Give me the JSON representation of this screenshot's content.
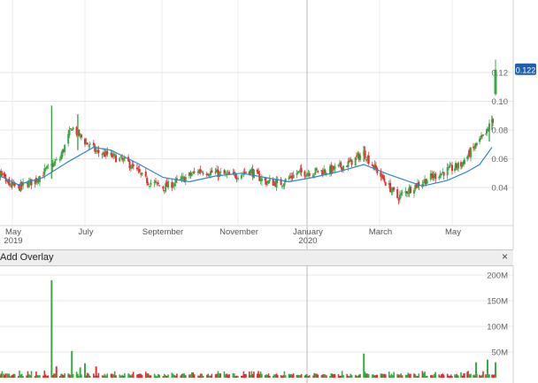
{
  "chart_data": [
    {
      "type": "candlestick",
      "title": "",
      "xlabel": "",
      "ylabel": "",
      "ylim": [
        0.02,
        0.135
      ],
      "y_ticks": [
        "0.04",
        "0.06",
        "0.08",
        "0.10",
        "0.12"
      ],
      "x_labels": [
        {
          "label": "May",
          "sub": "2019",
          "date": "2019-05"
        },
        {
          "label": "July",
          "sub": "",
          "date": "2019-07"
        },
        {
          "label": "September",
          "sub": "",
          "date": "2019-09"
        },
        {
          "label": "November",
          "sub": "",
          "date": "2019-11"
        },
        {
          "label": "January",
          "sub": "2020",
          "date": "2020-01"
        },
        {
          "label": "March",
          "sub": "",
          "date": "2020-03"
        },
        {
          "label": "May",
          "sub": "",
          "date": "2020-05"
        }
      ],
      "last_price": "0.122",
      "series": [
        {
          "name": "",
          "kind": "close",
          "trend": [
            [
              "2019-04-08",
              0.05
            ],
            [
              "2019-04-22",
              0.043
            ],
            [
              "2019-05-06",
              0.04
            ],
            [
              "2019-05-20",
              0.045
            ],
            [
              "2019-06-01",
              0.054
            ],
            [
              "2019-06-10",
              0.06
            ],
            [
              "2019-06-20",
              0.082
            ],
            [
              "2019-07-01",
              0.072
            ],
            [
              "2019-07-10",
              0.065
            ],
            [
              "2019-07-22",
              0.062
            ],
            [
              "2019-08-05",
              0.057
            ],
            [
              "2019-08-19",
              0.045
            ],
            [
              "2019-09-02",
              0.04
            ],
            [
              "2019-09-16",
              0.045
            ],
            [
              "2019-10-01",
              0.052
            ],
            [
              "2019-10-14",
              0.05
            ],
            [
              "2019-10-28",
              0.048
            ],
            [
              "2019-11-11",
              0.052
            ],
            [
              "2019-11-25",
              0.044
            ],
            [
              "2019-12-09",
              0.043
            ],
            [
              "2019-12-23",
              0.05
            ],
            [
              "2020-01-06",
              0.051
            ],
            [
              "2020-01-20",
              0.052
            ],
            [
              "2020-02-03",
              0.056
            ],
            [
              "2020-02-17",
              0.064
            ],
            [
              "2020-03-02",
              0.048
            ],
            [
              "2020-03-16",
              0.033
            ],
            [
              "2020-03-30",
              0.041
            ],
            [
              "2020-04-13",
              0.047
            ],
            [
              "2020-04-27",
              0.052
            ],
            [
              "2020-05-11",
              0.056
            ],
            [
              "2020-05-25",
              0.067
            ],
            [
              "2020-06-08",
              0.077
            ],
            [
              "2020-06-15",
              0.087
            ]
          ]
        },
        {
          "name": "",
          "kind": "moving_average",
          "color": "#2f86c8",
          "trend": [
            [
              "2019-04-08",
              0.048
            ],
            [
              "2019-05-06",
              0.042
            ],
            [
              "2019-05-27",
              0.047
            ],
            [
              "2019-06-17",
              0.058
            ],
            [
              "2019-07-08",
              0.068
            ],
            [
              "2019-07-22",
              0.066
            ],
            [
              "2019-08-12",
              0.057
            ],
            [
              "2019-09-02",
              0.047
            ],
            [
              "2019-09-23",
              0.044
            ],
            [
              "2019-10-14",
              0.048
            ],
            [
              "2019-11-04",
              0.05
            ],
            [
              "2019-11-25",
              0.047
            ],
            [
              "2019-12-16",
              0.044
            ],
            [
              "2020-01-06",
              0.047
            ],
            [
              "2020-01-27",
              0.051
            ],
            [
              "2020-02-17",
              0.056
            ],
            [
              "2020-03-09",
              0.049
            ],
            [
              "2020-04-06",
              0.041
            ],
            [
              "2020-04-27",
              0.045
            ],
            [
              "2020-05-18",
              0.051
            ],
            [
              "2020-06-01",
              0.056
            ],
            [
              "2020-06-15",
              0.068
            ]
          ]
        }
      ],
      "spikes": [
        {
          "date": "2019-06-03",
          "high": 0.097,
          "low": 0.046
        },
        {
          "date": "2019-06-25",
          "high": 0.091,
          "low": 0.066
        },
        {
          "date": "2020-02-17",
          "high": 0.069,
          "low": 0.058
        },
        {
          "date": "2020-06-12",
          "high": 0.084,
          "low": 0.072
        },
        {
          "date": "2020-06-15",
          "high": 0.09,
          "low": 0.08
        }
      ],
      "last_candle": {
        "date": "2020-06-19",
        "open": 0.105,
        "high": 0.129,
        "low": 0.104,
        "close": 0.122
      }
    },
    {
      "type": "bar",
      "title": "",
      "xlabel": "",
      "ylabel": "",
      "ylim": [
        0,
        225
      ],
      "y_ticks": [
        "50M",
        "100M",
        "150M",
        "200M"
      ],
      "spikes": [
        {
          "date": "2019-06-03",
          "value": 190,
          "color": "#3aa845"
        },
        {
          "date": "2019-06-07",
          "value": 22,
          "color": "#e03030"
        },
        {
          "date": "2019-06-20",
          "value": 52,
          "color": "#3aa845"
        },
        {
          "date": "2019-06-27",
          "value": 20,
          "color": "#3aa845"
        },
        {
          "date": "2019-07-01",
          "value": 28,
          "color": "#3aa845"
        },
        {
          "date": "2019-07-10",
          "value": 22,
          "color": "#e03030"
        },
        {
          "date": "2020-02-17",
          "value": 47,
          "color": "#3aa845"
        },
        {
          "date": "2020-05-28",
          "value": 30,
          "color": "#3aa845"
        },
        {
          "date": "2020-06-10",
          "value": 35,
          "color": "#3aa845"
        },
        {
          "date": "2020-06-19",
          "value": 30,
          "color": "#3aa845"
        }
      ],
      "typical_range": [
        3,
        14
      ]
    }
  ],
  "overlay_bar": {
    "label": "Add Overlay",
    "close": "×"
  }
}
